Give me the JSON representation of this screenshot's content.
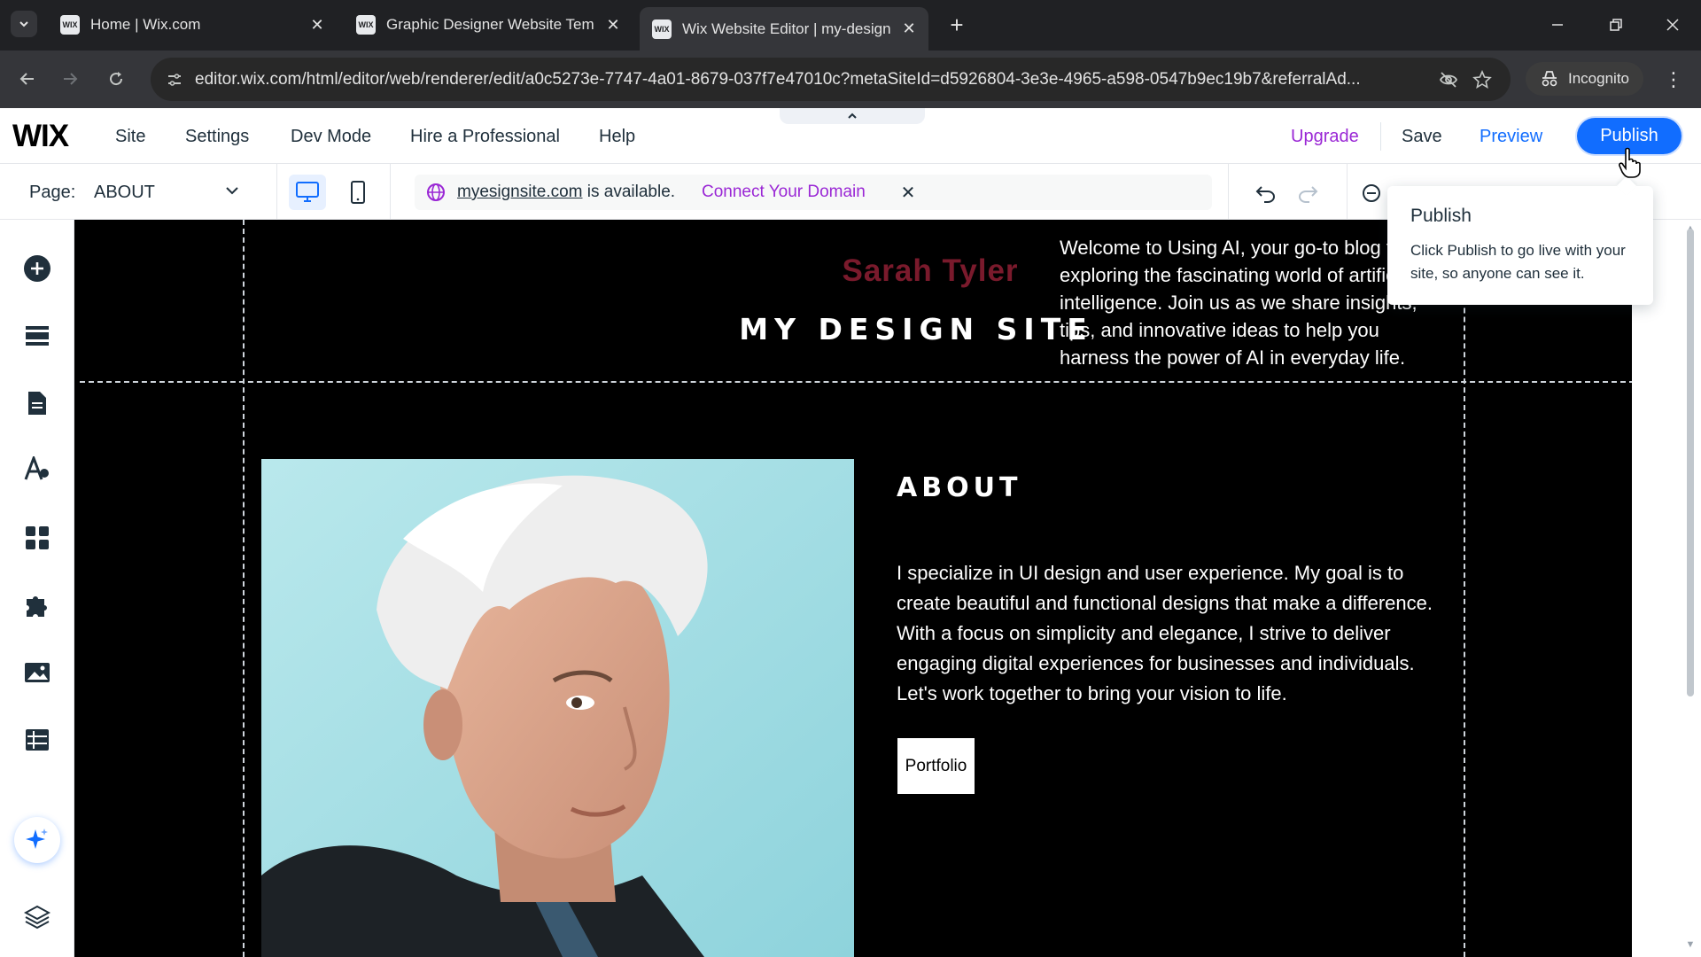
{
  "browser": {
    "tabs": [
      {
        "title": "Home | Wix.com",
        "favicon": "WIX"
      },
      {
        "title": "Graphic Designer Website Tem",
        "favicon": "WIX"
      },
      {
        "title": "Wix Website Editor | my-design",
        "favicon": "WIX"
      }
    ],
    "url": "editor.wix.com/html/editor/web/renderer/edit/a0c5273e-7747-4a01-8679-037f7e47010c?metaSiteId=d5926804-3e3e-4965-a598-0547b9ec19b7&referralAd...",
    "incognito_label": "Incognito"
  },
  "editor": {
    "logo": "WIX",
    "menu": [
      "Site",
      "Settings",
      "Dev Mode",
      "Hire a Professional",
      "Help"
    ],
    "upgrade": "Upgrade",
    "save": "Save",
    "preview": "Preview",
    "publish": "Publish",
    "page_label": "Page:",
    "page_value": "ABOUT",
    "domain": {
      "link": "myesignsite.com",
      "text": "is available.",
      "cta": "Connect Your Domain"
    },
    "colors": {
      "accent": "#116dff",
      "upgrade": "#9a27d5"
    }
  },
  "tooltip": {
    "title": "Publish",
    "body": "Click Publish to go live with your site, so anyone can see it."
  },
  "site": {
    "name": "Sarah Tyler",
    "title": "MY DESIGN SITE",
    "intro": "Welcome to Using AI, your go-to blog for exploring the fascinating world of artificial intelligence. Join us as we share insights, tips, and innovative ideas to help you harness the power of AI in everyday life.",
    "about_heading": "ABOUT",
    "about_body": "I specialize in UI design and user experience. My goal is to create beautiful and functional designs that make a difference. With a focus on simplicity and elegance, I strive to deliver engaging digital experiences for businesses and individuals. Let's work together to bring your vision to life.",
    "portfolio_button": "Portfolio"
  }
}
